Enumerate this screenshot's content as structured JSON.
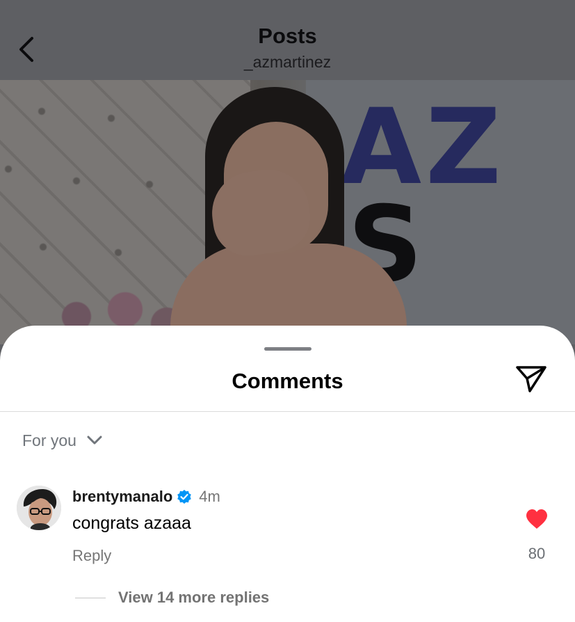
{
  "header": {
    "title": "Posts",
    "username": "_azmartinez"
  },
  "comments_sheet": {
    "title": "Comments",
    "sort_label": "For you"
  },
  "comment": {
    "username": "brentymanalo",
    "verified": true,
    "time": "4m",
    "text": "congrats azaaa",
    "reply_label": "Reply",
    "like_count": "80",
    "liked": true,
    "view_replies_label": "View 14 more replies"
  },
  "banner_text": {
    "line1": "AZ",
    "line2": "S"
  },
  "colors": {
    "like_red": "#ff3040",
    "verified_blue": "#0095f6",
    "secondary_text": "#767676"
  },
  "icons": {
    "back": "chevron-left-icon",
    "share": "paper-plane-icon",
    "sort": "chevron-down-icon",
    "verified": "verified-badge-icon",
    "like": "heart-icon"
  }
}
